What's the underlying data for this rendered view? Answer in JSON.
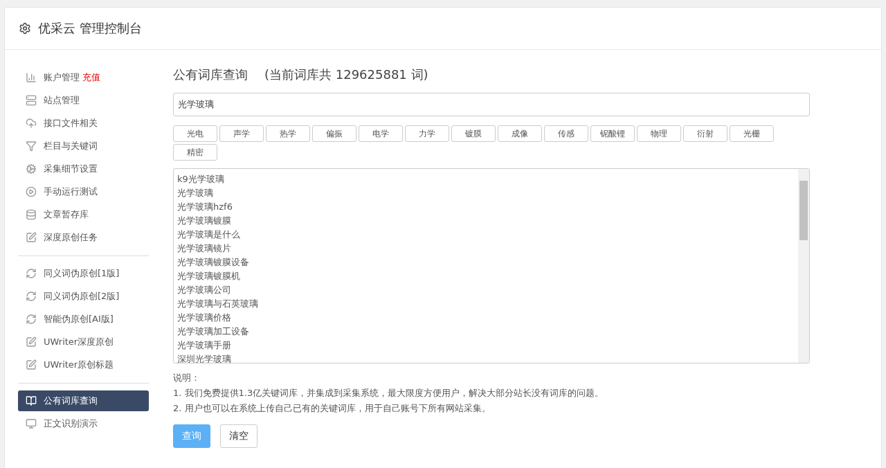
{
  "header": {
    "title": "优采云 管理控制台"
  },
  "sidebar": {
    "groups": [
      {
        "items": [
          {
            "label": "账户管理",
            "badge": "充值",
            "selected": false
          },
          {
            "label": "站点管理",
            "selected": false
          },
          {
            "label": "接口文件相关",
            "selected": false
          },
          {
            "label": "栏目与关键词",
            "selected": false
          },
          {
            "label": "采集细节设置",
            "selected": false
          },
          {
            "label": "手动运行测试",
            "selected": false
          },
          {
            "label": "文章暂存库",
            "selected": false
          },
          {
            "label": "深度原创任务",
            "selected": false
          }
        ]
      },
      {
        "items": [
          {
            "label": "同义词伪原创[1版]",
            "selected": false
          },
          {
            "label": "同义词伪原创[2版]",
            "selected": false
          },
          {
            "label": "智能伪原创[AI版]",
            "selected": false
          },
          {
            "label": "UWriter深度原创",
            "selected": false
          },
          {
            "label": "UWriter原创标题",
            "selected": false
          }
        ]
      },
      {
        "items": [
          {
            "label": "公有词库查询",
            "selected": true
          },
          {
            "label": "正文识别演示",
            "selected": false
          }
        ]
      }
    ]
  },
  "main": {
    "title": "公有词库查询",
    "count_note": "(当前词库共 129625881 词)",
    "search": {
      "value": "光学玻璃"
    },
    "tags": [
      "光电",
      "声学",
      "热学",
      "偏振",
      "电学",
      "力学",
      "镀膜",
      "成像",
      "传感",
      "铌酸锂",
      "物理",
      "衍射",
      "光栅",
      "精密"
    ],
    "results": [
      "k9光学玻璃",
      "光学玻璃",
      "光学玻璃hzf6",
      "光学玻璃镀膜",
      "光学玻璃是什么",
      "光学玻璃镜片",
      "光学玻璃镀膜设备",
      "光学玻璃镀膜机",
      "光学玻璃公司",
      "光学玻璃与石英玻璃",
      "光学玻璃价格",
      "光学玻璃加工设备",
      "光学玻璃手册",
      "深圳光学玻璃"
    ],
    "notes_title": "说明：",
    "notes": [
      "1. 我们免费提供1.3亿关键词库，并集成到采集系统，最大限度方便用户，解决大部分站长没有词库的问题。",
      "2. 用户也可以在系统上传自己已有的关键词库，用于自己账号下所有网站采集。"
    ],
    "buttons": [
      {
        "label": "查询",
        "kind": "primary"
      },
      {
        "label": "清空",
        "kind": "default"
      }
    ]
  }
}
